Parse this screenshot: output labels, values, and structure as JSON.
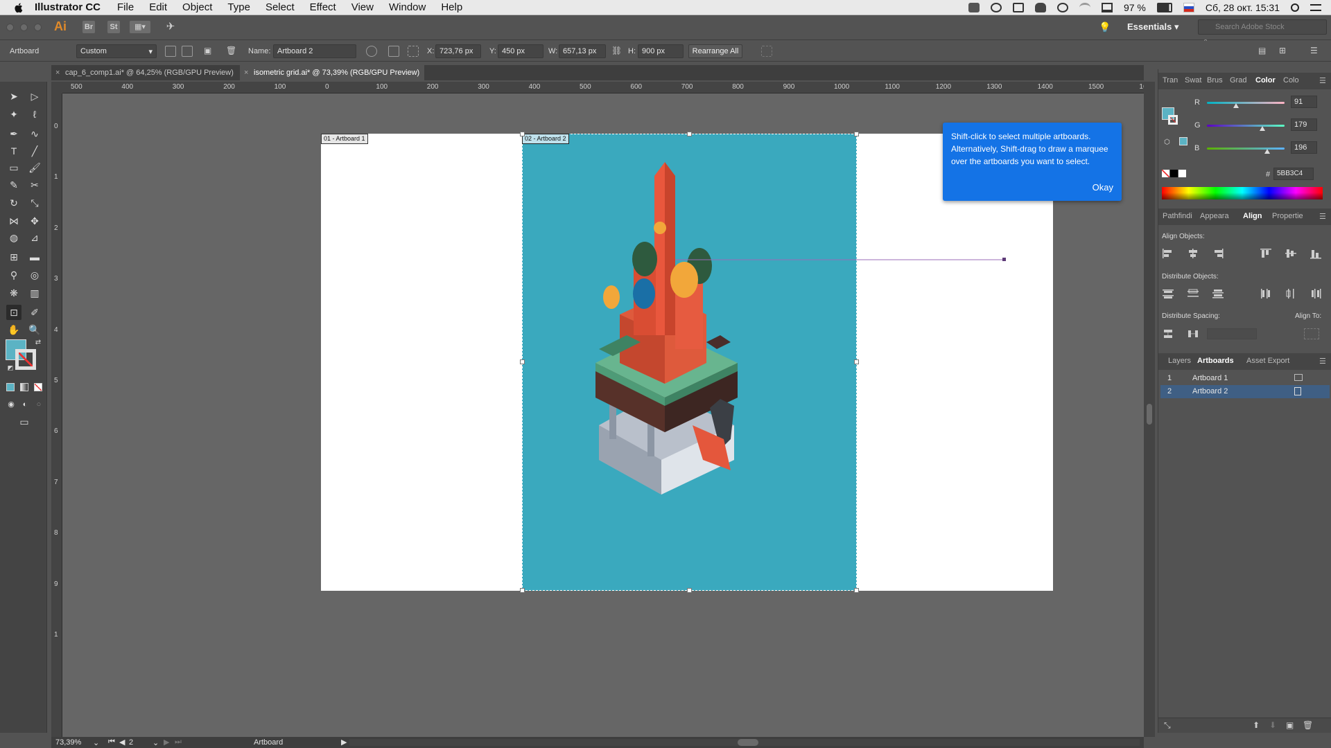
{
  "menubar": {
    "app_name": "Illustrator CC",
    "items": [
      "File",
      "Edit",
      "Object",
      "Type",
      "Select",
      "Effect",
      "View",
      "Window",
      "Help"
    ],
    "battery": "97 %",
    "datetime": "Сб, 28 окт. 15:31"
  },
  "appbar": {
    "logo": "Ai",
    "bridge": "Br",
    "stock": "St",
    "workspace": "Essentials",
    "search_placeholder": "Search Adobe Stock"
  },
  "control": {
    "mode_label": "Artboard",
    "preset": "Custom",
    "name_label": "Name:",
    "name_value": "Artboard 2",
    "x_label": "X:",
    "x_value": "723,76 px",
    "y_label": "Y:",
    "y_value": "450 px",
    "w_label": "W:",
    "w_value": "657,13 px",
    "h_label": "H:",
    "h_value": "900 px",
    "rearrange": "Rearrange All"
  },
  "tabs": [
    {
      "label": "cap_6_comp1.ai* @ 64,25% (RGB/GPU Preview)",
      "active": false
    },
    {
      "label": "isometric grid.ai* @ 73,39% (RGB/GPU Preview)",
      "active": true
    }
  ],
  "ruler": {
    "top": [
      "500",
      "400",
      "300",
      "200",
      "100",
      "0",
      "100",
      "200",
      "300",
      "400",
      "500",
      "600",
      "700",
      "800",
      "900",
      "1000",
      "1100",
      "1200",
      "1300",
      "1400",
      "1500",
      "16"
    ],
    "left": [
      "0",
      "1",
      "2",
      "3",
      "4",
      "5",
      "6",
      "7",
      "8",
      "9",
      "1"
    ]
  },
  "artboards": {
    "label1": "01 - Artboard 1",
    "label2": "02 - Artboard 2",
    "artboard2_color": "#3AA9BE"
  },
  "tooltip": {
    "text": "Shift-click to select multiple artboards. Alternatively, Shift-drag to draw a marquee over the artboards you want to select.",
    "button": "Okay"
  },
  "color_panel": {
    "tabs": [
      "Tran",
      "Swat",
      "Brus",
      "Grad",
      "Color",
      "Colo"
    ],
    "active_tab": "Color",
    "r_label": "R",
    "r_value": "91",
    "g_label": "G",
    "g_value": "179",
    "b_label": "B",
    "b_value": "196",
    "hex_label": "#",
    "hex": "5BB3C4"
  },
  "align_panel": {
    "tabs": [
      "Pathfindi",
      "Appeara",
      "Align",
      "Propertie"
    ],
    "active_tab": "Align",
    "align_objects": "Align Objects:",
    "distribute_objects": "Distribute Objects:",
    "distribute_spacing": "Distribute Spacing:",
    "align_to": "Align To:"
  },
  "artboards_panel": {
    "tabs": [
      "Layers",
      "Artboards",
      "Asset Export"
    ],
    "active_tab": "Artboards",
    "rows": [
      {
        "num": "1",
        "name": "Artboard 1",
        "selected": false
      },
      {
        "num": "2",
        "name": "Artboard 2",
        "selected": true
      }
    ]
  },
  "statusbar": {
    "zoom": "73,39%",
    "page": "2",
    "tool": "Artboard"
  }
}
